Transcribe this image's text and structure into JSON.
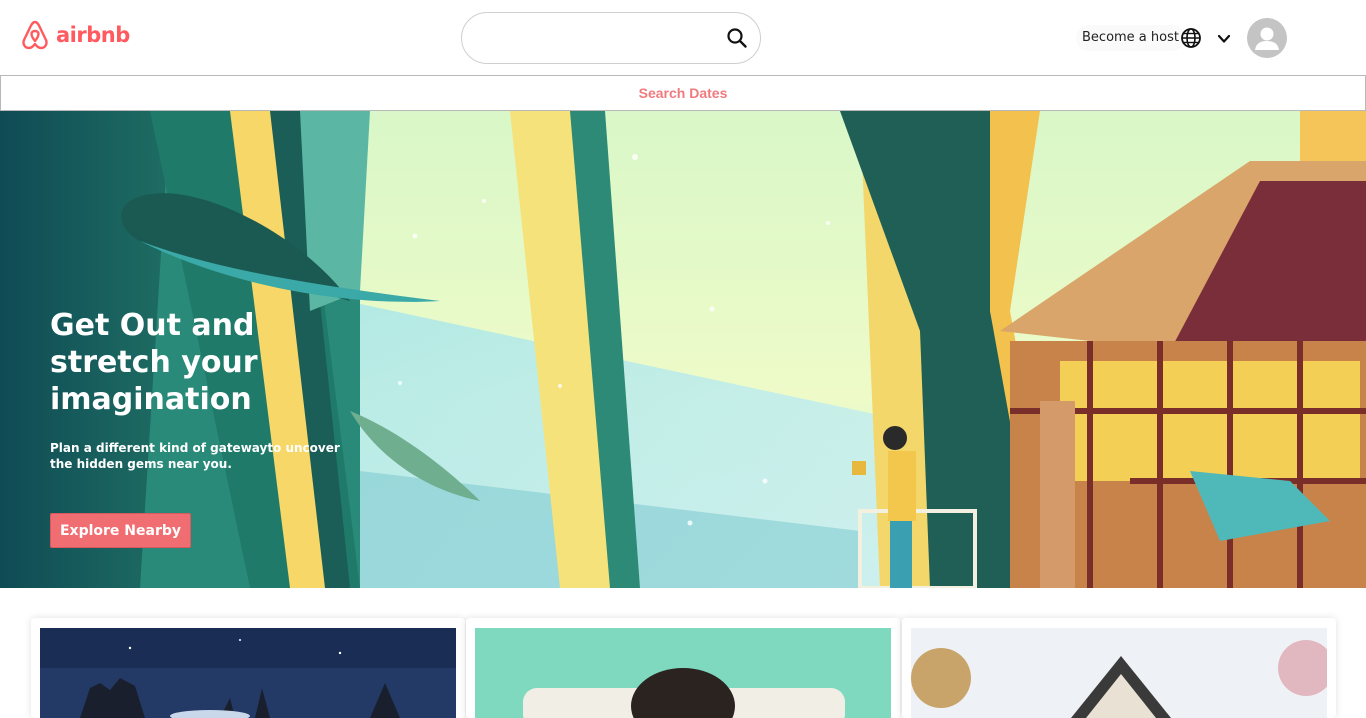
{
  "header": {
    "brand": "airbnb",
    "search": {
      "value": "",
      "placeholder": ""
    },
    "host_label": "Become a host"
  },
  "dates_bar": {
    "label": "Search Dates"
  },
  "hero": {
    "title": "Get Out and stretch your imagination",
    "subtitle": "Plan a different kind of gatewayto uncover the hidden gems near you.",
    "button_label": "Explore Nearby"
  },
  "icons": {
    "logo": "airbnb-logo-icon",
    "search": "search-icon",
    "globe": "globe-icon",
    "chevron": "chevron-down-icon",
    "avatar": "user-avatar-icon"
  },
  "colors": {
    "brand": "#ff5a5f",
    "button": "#f06d72",
    "dates_text": "#f07b7e"
  }
}
